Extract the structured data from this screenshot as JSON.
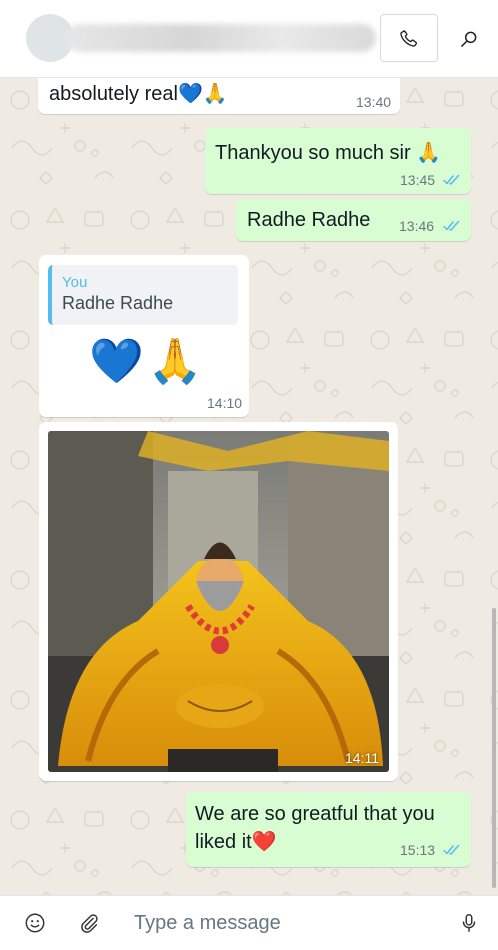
{
  "header": {
    "call_icon": "phone-icon",
    "search_icon": "search-icon"
  },
  "messages": [
    {
      "type": "in",
      "text": "absolutely real",
      "emoji": "💙🙏",
      "time": "13:40"
    },
    {
      "type": "out",
      "text": "Thankyou so much sir",
      "emoji": "🙏",
      "time": "13:45",
      "ticks": "read"
    },
    {
      "type": "out",
      "text": "Radhe Radhe",
      "time": "13:46",
      "ticks": "read"
    },
    {
      "type": "in-reply",
      "quote_author": "You",
      "quote_text": "Radhe Radhe",
      "emoji": "💙🙏",
      "time": "14:10"
    },
    {
      "type": "in-photo",
      "time": "14:11"
    },
    {
      "type": "out",
      "text_line1": "We are so greatful that you",
      "text_line2": "liked it",
      "emoji": "❤️",
      "time": "15:13",
      "ticks": "read"
    }
  ],
  "composer": {
    "placeholder": "Type a message",
    "emoji_icon": "smiley-icon",
    "attach_icon": "paperclip-icon",
    "mic_icon": "microphone-icon"
  },
  "colors": {
    "incoming": "#ffffff",
    "outgoing": "#d9fdd3",
    "read_ticks": "#53bdeb",
    "chat_bg": "#efeae2"
  }
}
